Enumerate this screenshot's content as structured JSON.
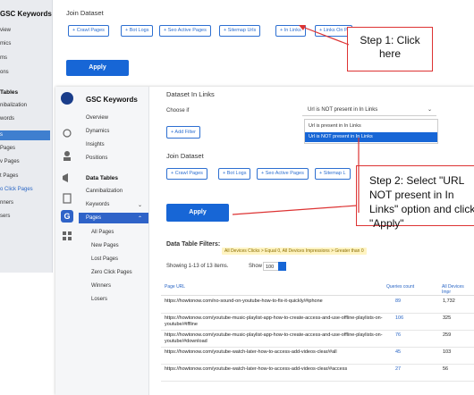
{
  "back": {
    "app_title": "GSC Keywords",
    "sidebar": [
      "view",
      "mics",
      "ms",
      "ons"
    ],
    "data_tables_head": "Tables",
    "sidebar2": [
      "nibalization",
      "words",
      "s",
      "Pages",
      "v Pages",
      "t Pages",
      "o Click Pages",
      "nners",
      "sers"
    ],
    "join_title": "Join Dataset",
    "chips": [
      "+ Crawl Pages",
      "+ Bot Logs",
      "+ Seo Active Pages",
      "+ Sitemap Urls",
      "+ In Links",
      "+ Links On P"
    ],
    "apply": "Apply"
  },
  "callout1": "Step 1: Click here",
  "callout2": "Step 2: Select \"URL NOT present in In Links\" option and click \"Apply\"",
  "front": {
    "app_title": "GSC Keywords",
    "sidebar_items": [
      "Overview",
      "Dynamics",
      "Insights",
      "Positions"
    ],
    "data_tables": "Data Tables",
    "sub_items": [
      "Cannibalization",
      "Keywords",
      "Pages"
    ],
    "pages_sub": [
      "All Pages",
      "New Pages",
      "Lost Pages",
      "Zero Click Pages",
      "Winners",
      "Losers"
    ],
    "dataset_title": "Dataset In Links",
    "choose_if": "Choose if",
    "select_value": "Url is NOT present in In Links",
    "options": [
      "Url is present in In Links",
      "Url is NOT present in In Links"
    ],
    "add_filter": "+ Add Filter",
    "join_title": "Join Dataset",
    "chips": [
      "+ Crawl Pages",
      "+ Bot Logs",
      "+ Seo Active Pages",
      "+ Sitemap L"
    ],
    "apply": "Apply",
    "filters_label": "Data Table Filters:",
    "filters_value": "All Devices Clicks > Equal 0, All Devices Impressions > Greater than 0",
    "showing": "Showing 1-13 of 13 items.",
    "show_label": "Show",
    "show_value": "100",
    "columns": [
      "Page URL",
      "Queries count",
      "All Devices Impr"
    ],
    "rows": [
      {
        "url": "https://howtonow.com/no-sound-on-youtube-how-to-fix-it-quickly/#iphone",
        "q": "89",
        "i": "1,732"
      },
      {
        "url": "https://howtonow.com/youtube-music-playlist-app-how-to-create-access-and-use-offline-playlists-on-youtube/#iffline",
        "q": "106",
        "i": "325"
      },
      {
        "url": "https://howtonow.com/youtube-music-playlist-app-how-to-create-access-and-use-offline-playlists-on-youtube/#download",
        "q": "76",
        "i": "259"
      },
      {
        "url": "https://howtonow.com/youtube-watch-later-how-to-access-add-videos-clear/#all",
        "q": "45",
        "i": "103"
      },
      {
        "url": "https://howtonow.com/youtube-watch-later-how-to-access-add-videos-clear/#access",
        "q": "27",
        "i": "56"
      }
    ]
  }
}
